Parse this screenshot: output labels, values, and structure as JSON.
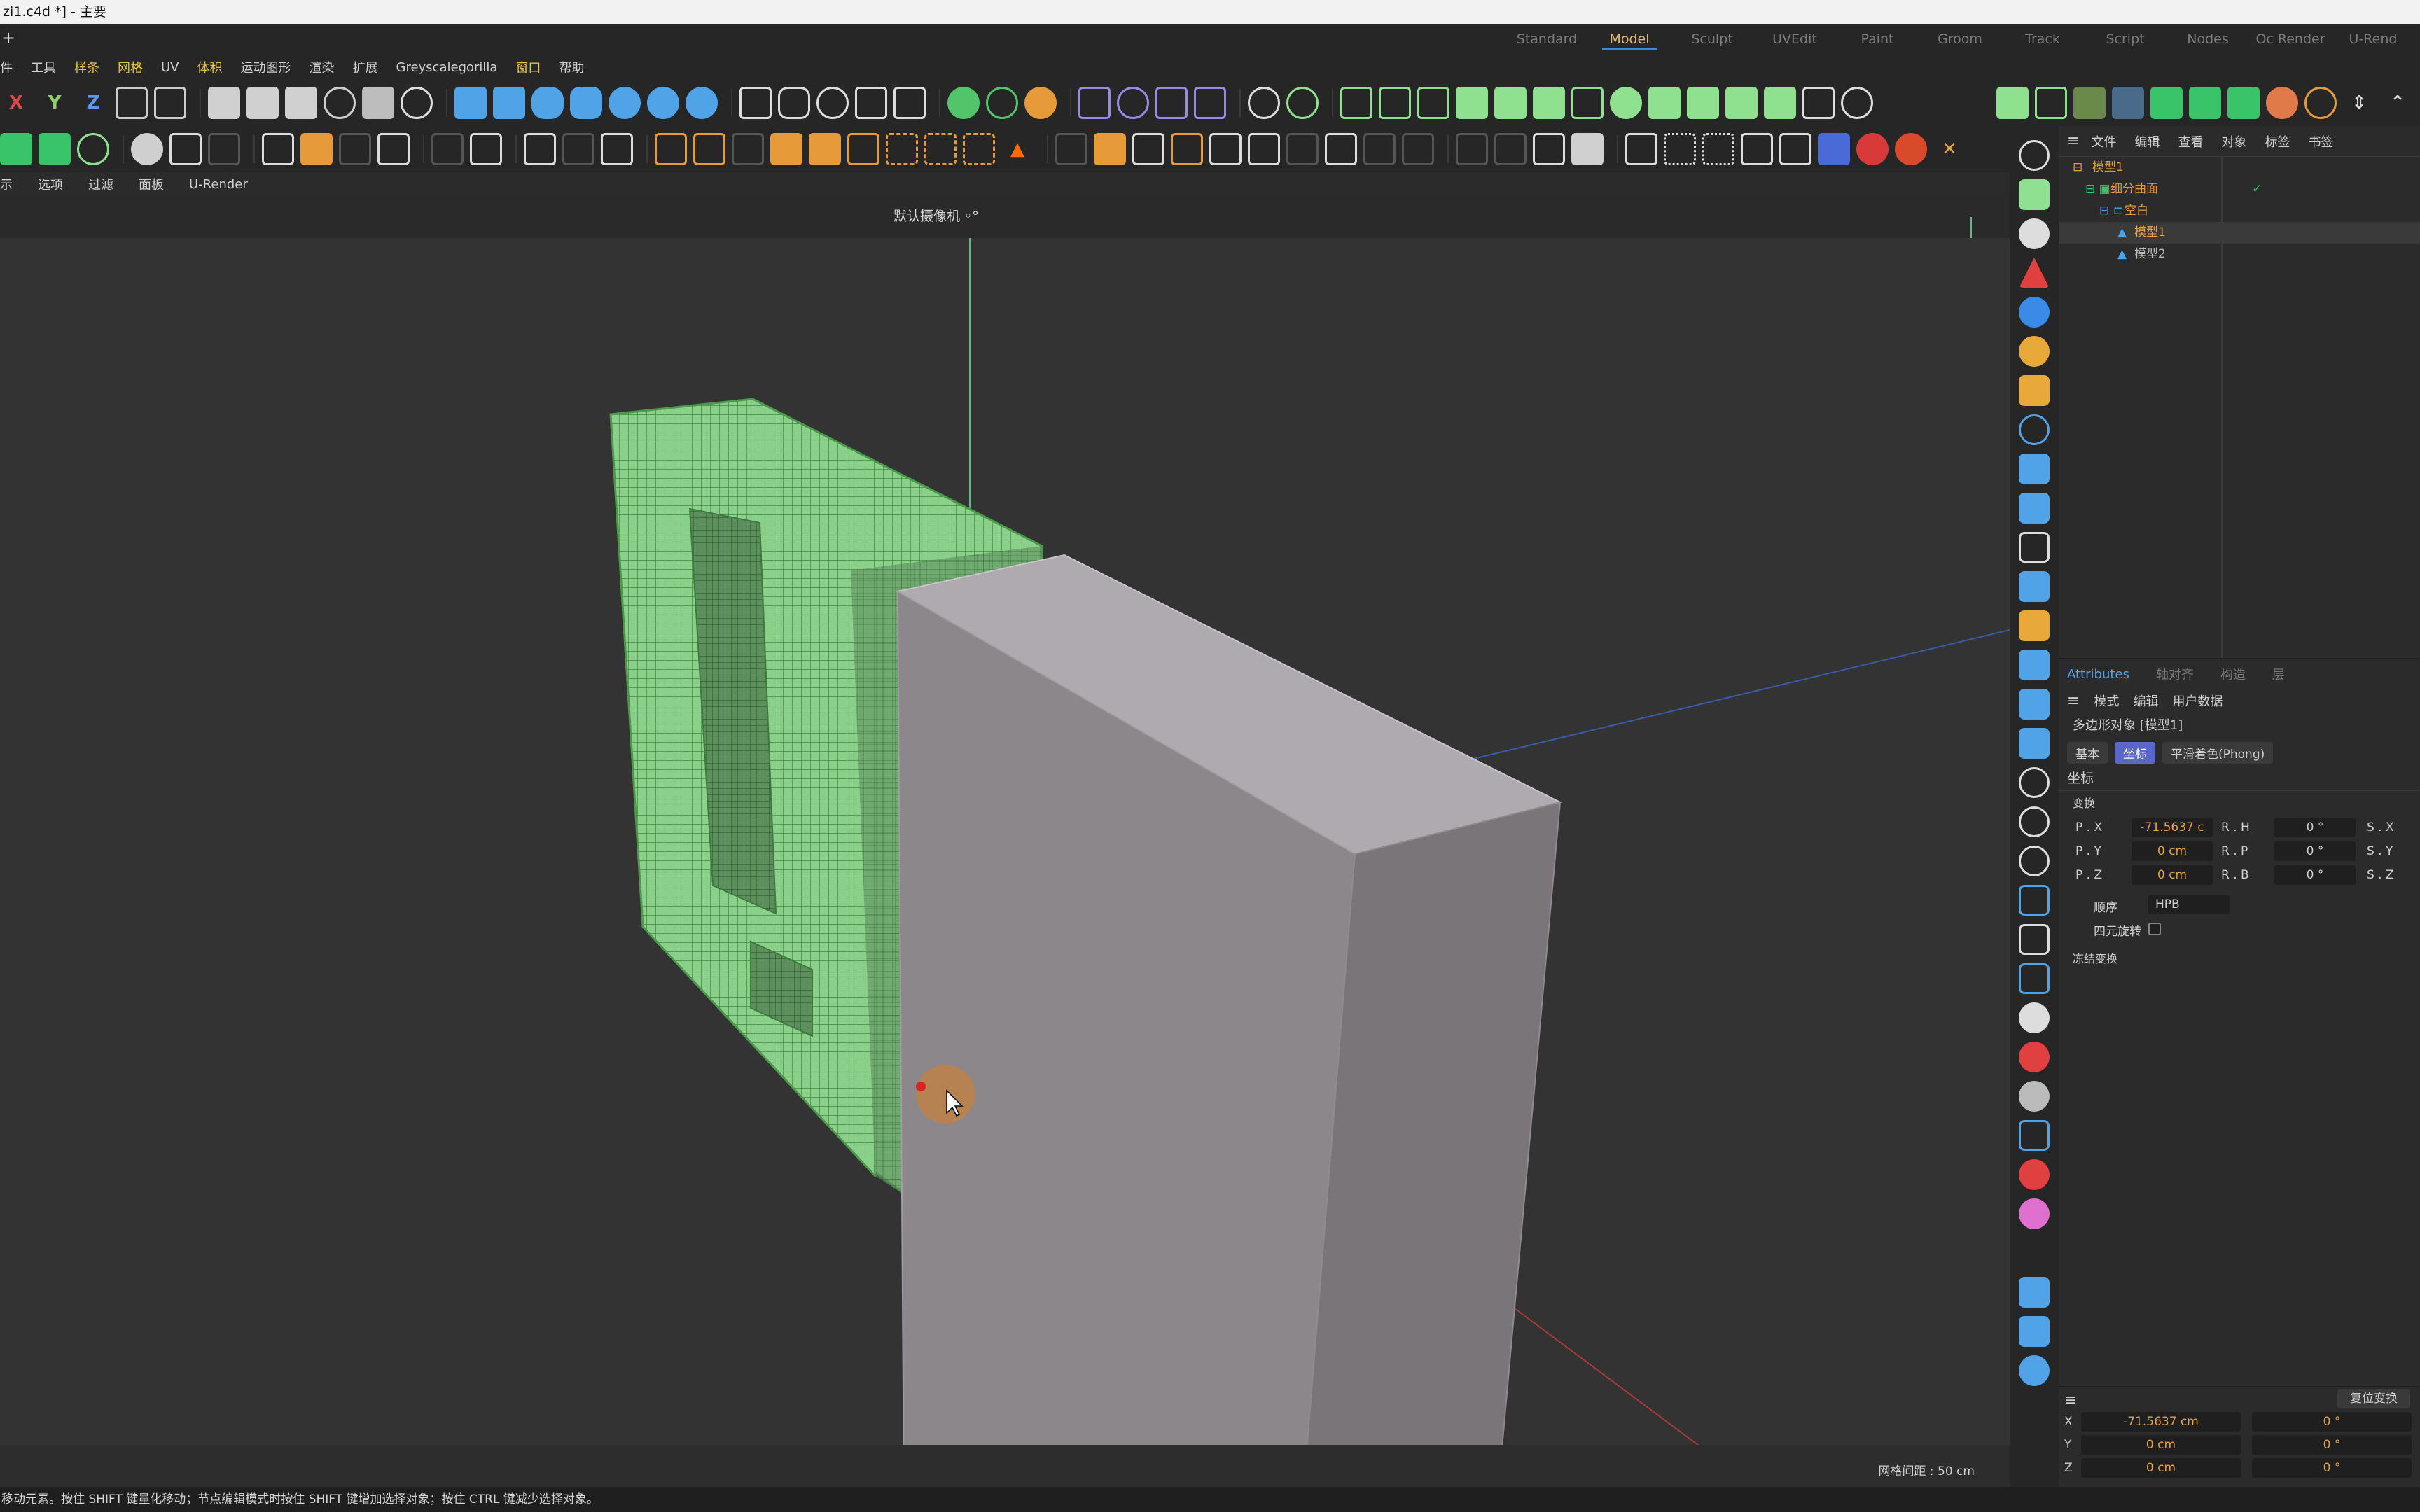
{
  "window": {
    "title": "zi1.c4d *] - 主要"
  },
  "layout_bar": {
    "new_tab": "+"
  },
  "layouts": [
    {
      "label": "Standard",
      "active": false
    },
    {
      "label": "Model",
      "active": true
    },
    {
      "label": "Sculpt",
      "active": false
    },
    {
      "label": "UVEdit",
      "active": false
    },
    {
      "label": "Paint",
      "active": false
    },
    {
      "label": "Groom",
      "active": false
    },
    {
      "label": "Track",
      "active": false
    },
    {
      "label": "Script",
      "active": false
    },
    {
      "label": "Nodes",
      "active": false
    },
    {
      "label": "Oc Render",
      "active": false
    },
    {
      "label": "U-Rend",
      "active": false
    }
  ],
  "main_menu": [
    "件",
    "工具",
    "样条",
    "网格",
    "UV",
    "体积",
    "运动图形",
    "渲染",
    "扩展",
    "Greyscalegorilla",
    "窗口",
    "帮助"
  ],
  "axis_locks": {
    "x": "X",
    "y": "Y",
    "z": "Z"
  },
  "view_menu": [
    "示",
    "选项",
    "过滤",
    "面板",
    "U-Render"
  ],
  "viewport": {
    "camera_label": "默认摄像机 ◦︎°",
    "grid_spacing": "网格间距 : 50 cm"
  },
  "object_manager": {
    "menu": [
      "文件",
      "编辑",
      "查看",
      "对象",
      "标签",
      "书签"
    ],
    "objects": [
      {
        "name": "模型1",
        "depth": 0
      },
      {
        "name": "细分曲面",
        "depth": 1
      },
      {
        "name": "空白",
        "depth": 2
      },
      {
        "name": "模型1",
        "depth": 3
      },
      {
        "name": "模型2",
        "depth": 3
      }
    ]
  },
  "attributes": {
    "tabs": [
      {
        "label": "Attributes",
        "active": true
      },
      {
        "label": "轴对齐",
        "active": false
      },
      {
        "label": "构造",
        "active": false
      },
      {
        "label": "层",
        "active": false
      }
    ],
    "menu": [
      "模式",
      "编辑",
      "用户数据"
    ],
    "object_title": "多边形对象 [模型1]",
    "subtabs": [
      {
        "label": "基本",
        "active": false
      },
      {
        "label": "坐标",
        "active": true
      },
      {
        "label": "平滑着色(Phong)",
        "active": false
      }
    ],
    "section_title": "坐标",
    "transform_group": "变换",
    "params": {
      "px_label": "P . X",
      "px": "-71.5637 c",
      "py_label": "P . Y",
      "py": "0 cm",
      "pz_label": "P . Z",
      "pz": "0 cm",
      "rh_label": "R . H",
      "rh": "0 °",
      "rp_label": "R . P",
      "rp": "0 °",
      "rb_label": "R . B",
      "rb": "0 °",
      "sx_label": "S . X",
      "sy_label": "S . Y",
      "sz_label": "S . Z"
    },
    "order_label": "顺序",
    "order_value": "HPB",
    "quaternion_label": "四元旋转",
    "frozen_label": "冻结变换"
  },
  "coordinates": {
    "reset_button": "复位变换",
    "rows": [
      {
        "axis": "X",
        "value": "-71.5637 cm",
        "rot": "0 °"
      },
      {
        "axis": "Y",
        "value": "0 cm",
        "rot": "0 °"
      },
      {
        "axis": "Z",
        "value": "0 cm",
        "rot": "0 °"
      }
    ]
  },
  "status_bar": {
    "text": "移动元素。按住 SHIFT 键量化移动；节点编辑模式时按住 SHIFT 键增加选择对象；按住 CTRL 键减少选择对象。"
  },
  "colors": {
    "accent": "#e9b873",
    "selection_blue": "#5a66c8",
    "object_orange": "#e59a3a",
    "wireframe_green": "#77c877",
    "box_face": "#8b878b"
  }
}
